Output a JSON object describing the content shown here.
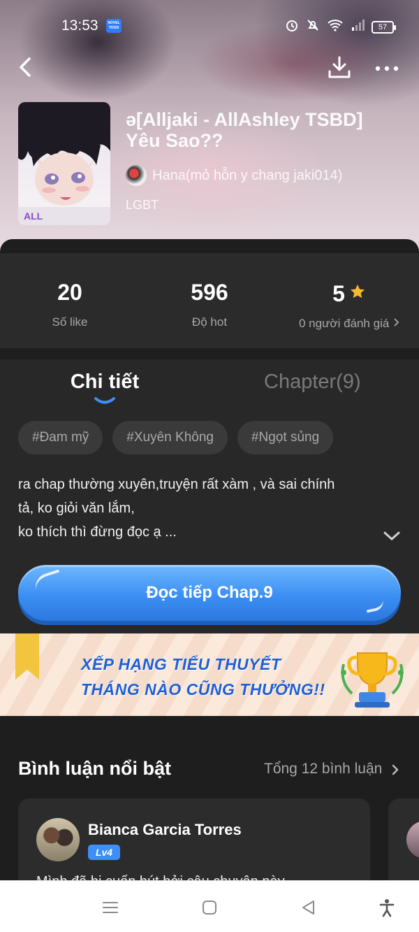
{
  "status_bar": {
    "time": "13:53",
    "app_badge": "NOVEL TOON",
    "battery": "57"
  },
  "book": {
    "title": "ə[Alljaki - AllAshley TSBD] Yêu Sao??",
    "author": "Hana(mỏ hỗn y chang jaki014)",
    "genre": "LGBT"
  },
  "stats": {
    "likes": {
      "value": "20",
      "label": "Số like"
    },
    "hot": {
      "value": "596",
      "label": "Độ hot"
    },
    "rating": {
      "value": "5",
      "label": "0 người đánh giá"
    }
  },
  "tabs": {
    "detail": "Chi tiết",
    "chapter": "Chapter(9)"
  },
  "tags": [
    "#Đam mỹ",
    "#Xuyên Không",
    "#Ngọt sủng"
  ],
  "description": {
    "line1": "ra chap thường xuyên,truyện rất xàm , và sai chính",
    "line2": "tả, ko giỏi văn  lắm,",
    "line3": "ko thích thì đừng đọc ạ ..."
  },
  "cta": {
    "label": "Đọc tiếp Chap.9"
  },
  "banner": {
    "line1": "XẾP HẠNG TIỂU THUYẾT",
    "line2": "THÁNG NÀO CŨNG THƯỞNG!!"
  },
  "comments": {
    "title": "Bình luận nổi bật",
    "total": "Tổng 12 bình luận",
    "items": [
      {
        "name": "Bianca Garcia Torres",
        "level": "Lv4",
        "text": "Mình đã bị cuốn hút bởi câu chuyện này..."
      }
    ]
  },
  "colors": {
    "accent": "#3c8ff3",
    "star": "#f5b82e",
    "background": "#1e1e1e"
  }
}
